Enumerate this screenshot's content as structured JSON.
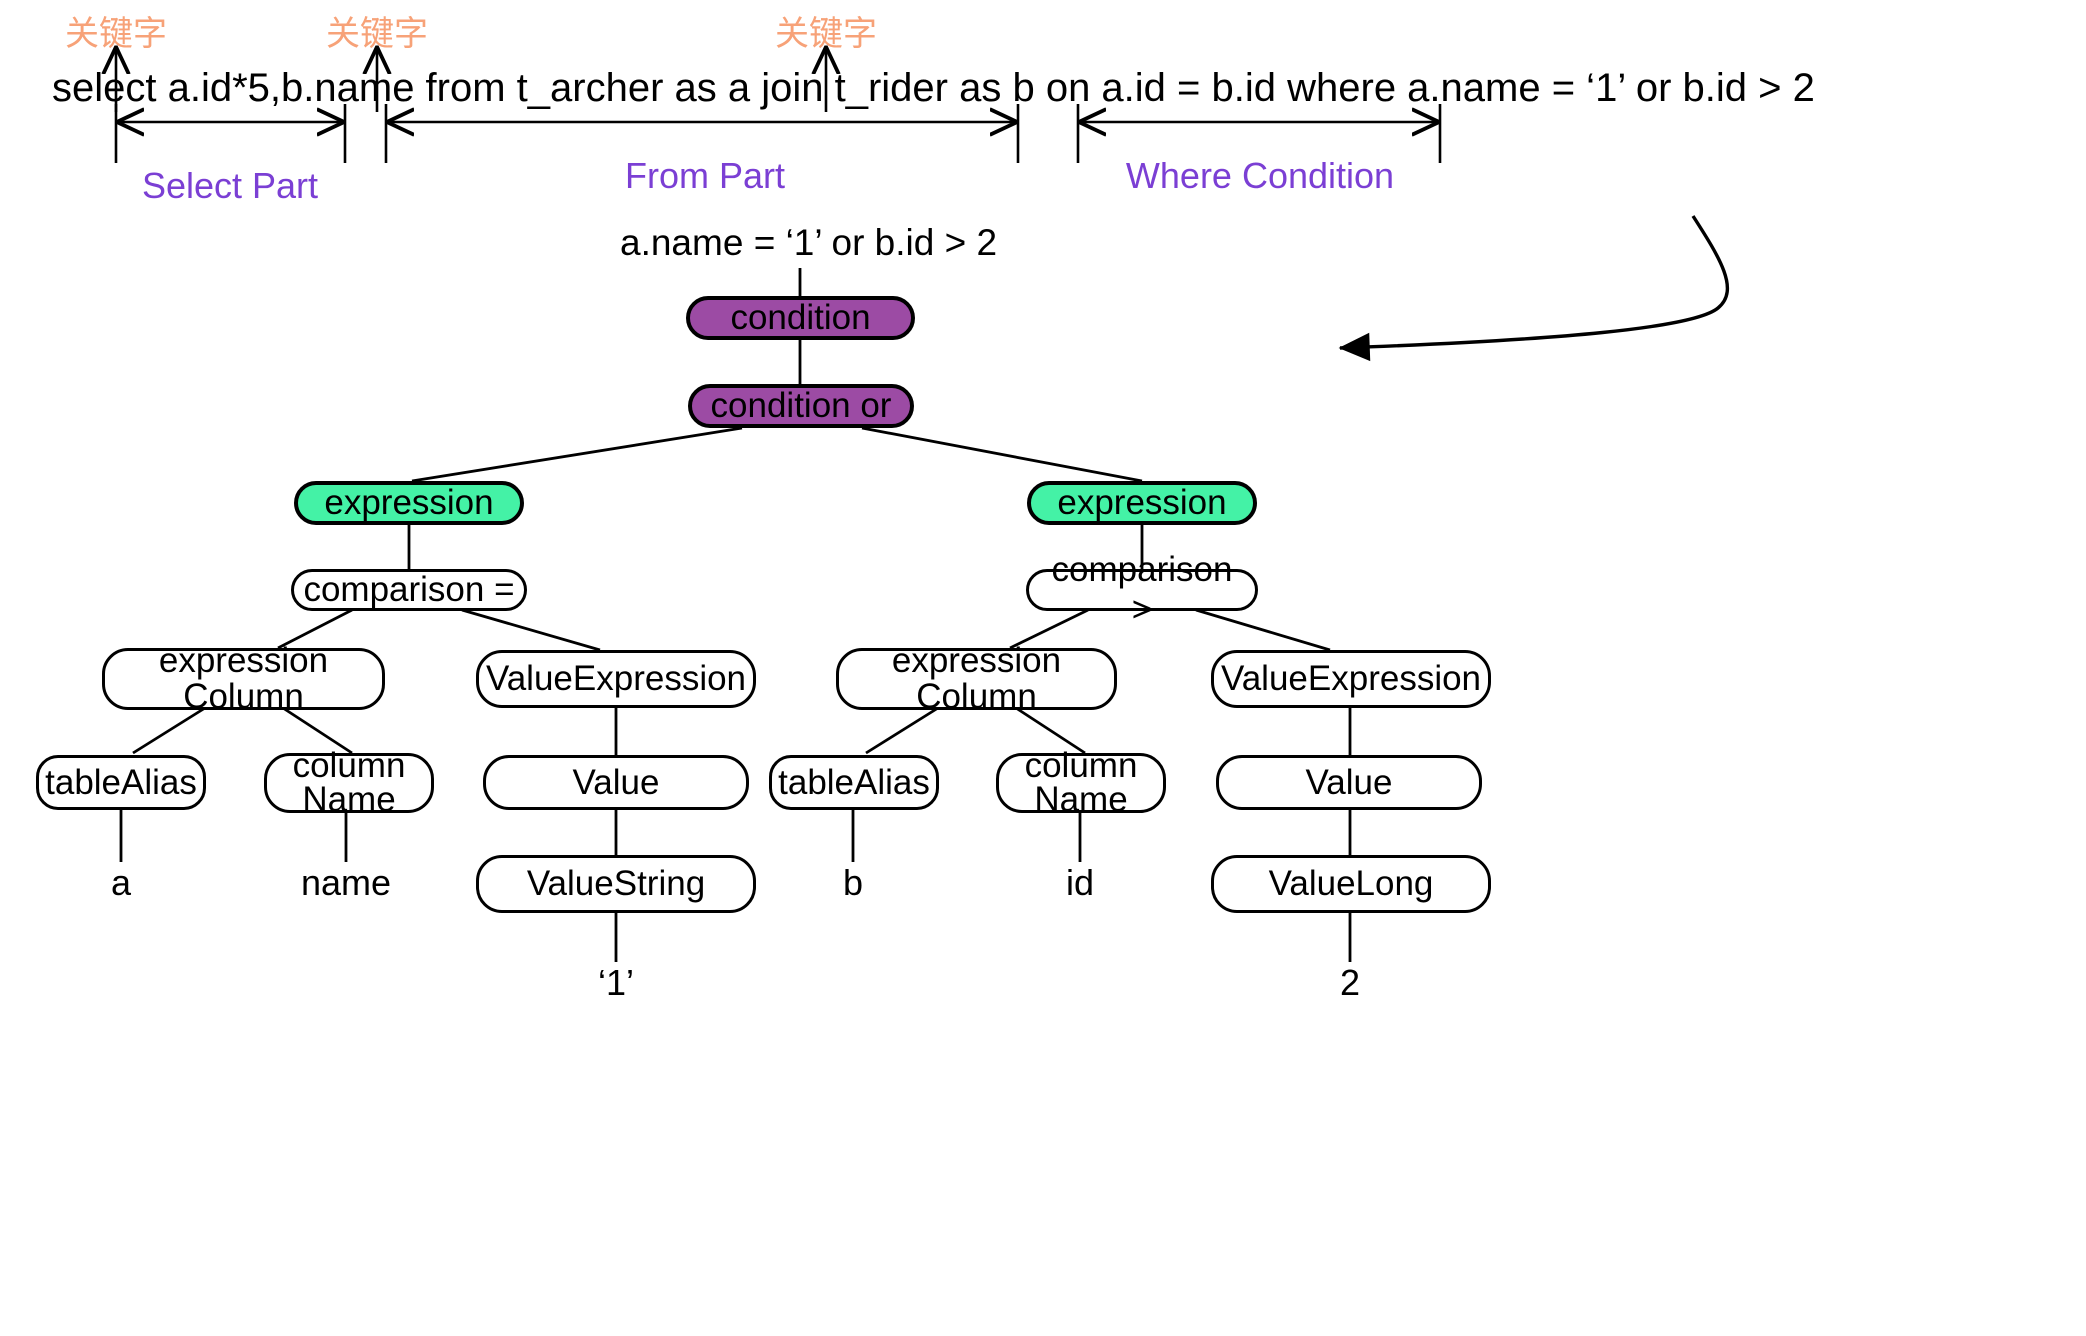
{
  "colors": {
    "keyword_label": "#F7A278",
    "part_label": "#7B3FD4",
    "condition_node": "#9C4BA4",
    "expression_node": "#44F2A6",
    "node_border": "#000000",
    "background": "#FFFFFF"
  },
  "sql": {
    "statement": "select a.id*5,b.name from t_archer as a join t_rider as b on a.id = b.id where a.name = ‘1’ or b.id > 2",
    "keyword_annotations": [
      {
        "label": "关键字",
        "points_to": "select"
      },
      {
        "label": "关键字",
        "points_to": "from"
      },
      {
        "label": "关键字",
        "points_to": "where"
      }
    ],
    "part_brackets": [
      {
        "label": "Select Part",
        "span": "a.id*5,b.name"
      },
      {
        "label": "From Part",
        "span": "t_archer as a join t_rider as b on a.id = b.id"
      },
      {
        "label": "Where Condition",
        "span": "a.name = ‘1’ or b.id > 2"
      }
    ]
  },
  "tree": {
    "caption": "a.name = ‘1’ or b.id > 2",
    "nodes": {
      "condition": "condition",
      "condition_or": "condition or",
      "expression_left": "expression",
      "expression_right": "expression",
      "comparison_eq": "comparison =",
      "comparison_gt": "comparison >",
      "expr_column_left_l1": "expression",
      "expr_column_left_l2": "Column",
      "expr_column_right_l1": "expression",
      "expr_column_right_l2": "Column",
      "value_expression_left": "ValueExpression",
      "value_expression_right": "ValueExpression",
      "table_alias_left": "tableAlias",
      "column_name_left_l1": "column",
      "column_name_left_l2": "Name",
      "table_alias_right": "tableAlias",
      "column_name_right_l1": "column",
      "column_name_right_l2": "Name",
      "value_left": "Value",
      "value_right": "Value",
      "value_string": "ValueString",
      "value_long": "ValueLong"
    },
    "leaves": {
      "table_alias_left_value": "a",
      "column_name_left_value": "name",
      "value_string_value": "‘1’",
      "table_alias_right_value": "b",
      "column_name_right_value": "id",
      "value_long_value": "2"
    }
  }
}
